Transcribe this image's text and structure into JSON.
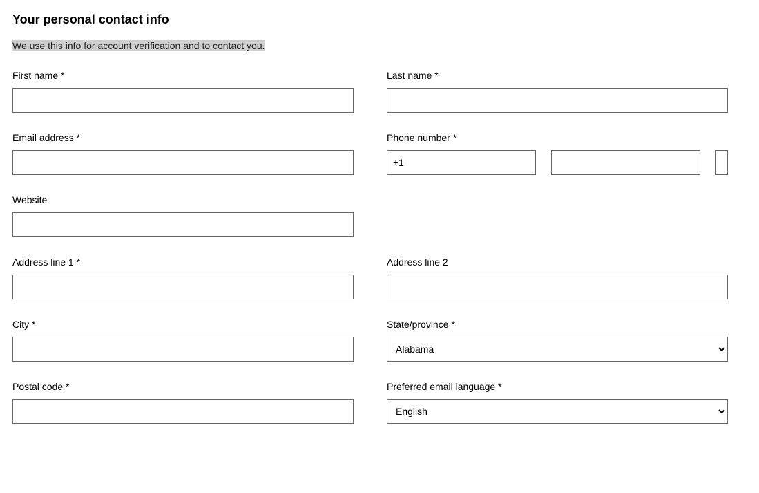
{
  "heading": "Your personal contact info",
  "subtext": "We use this info for account verification and to contact you.",
  "labels": {
    "first_name": "First name *",
    "last_name": "Last name *",
    "email": "Email address *",
    "phone": "Phone number *",
    "website": "Website",
    "address1": "Address line 1 *",
    "address2": "Address line 2",
    "city": "City *",
    "state": "State/province *",
    "postal": "Postal code *",
    "language": "Preferred email language *"
  },
  "values": {
    "first_name": "",
    "last_name": "",
    "email": "",
    "phone_country": "+1",
    "phone_area": "",
    "phone_number": "",
    "website": "",
    "address1": "",
    "address2": "",
    "city": "",
    "state": "Alabama",
    "postal": "",
    "language": "English"
  }
}
